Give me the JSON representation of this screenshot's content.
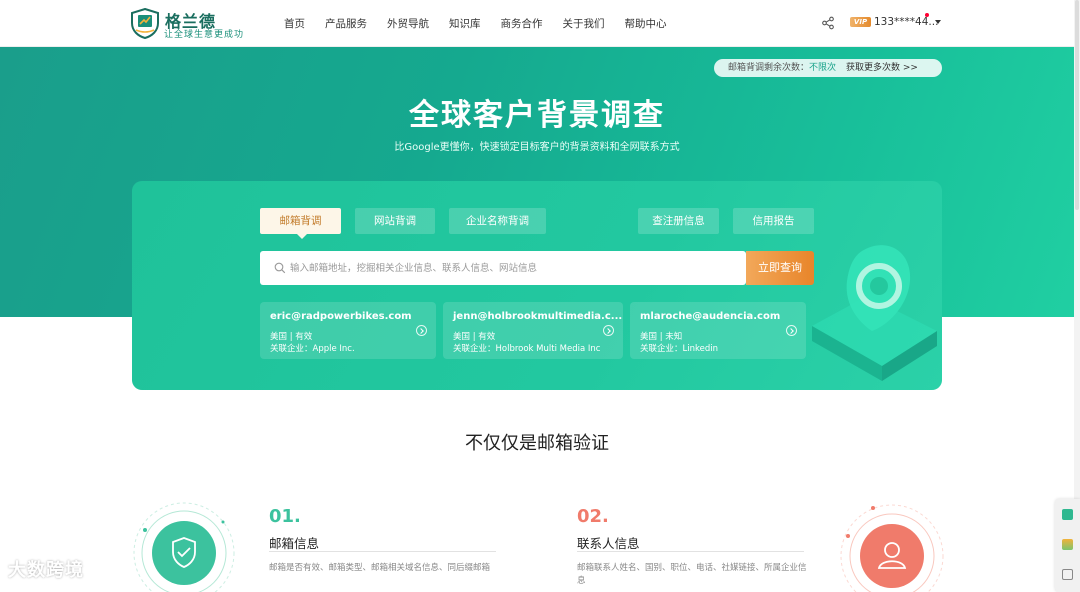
{
  "header": {
    "logo_name": "格兰德",
    "logo_slogan": "让全球生意更成功",
    "nav": [
      "首页",
      "产品服务",
      "外贸导航",
      "知识库",
      "商务合作",
      "关于我们",
      "帮助中心"
    ],
    "vip_badge": "VIP",
    "user_phone": "133****44...",
    "share_icon": "share-icon"
  },
  "hero": {
    "quota_label": "邮箱背调剩余次数：",
    "quota_value": "不限次",
    "quota_more": "获取更多次数 >>",
    "title": "全球客户背景调查",
    "subtitle": "比Google更懂你，快速锁定目标客户的背景资料和全网联系方式"
  },
  "search": {
    "tabs": [
      "邮箱背调",
      "网站背调",
      "企业名称背调",
      "查注册信息",
      "信用报告"
    ],
    "active_tab": "邮箱背调",
    "placeholder": "输入邮箱地址，挖掘相关企业信息、联系人信息、网站信息",
    "button": "立即查询"
  },
  "samples": [
    {
      "email": "eric@radpowerbikes.com",
      "meta": "美国 | 有效",
      "corp": "关联企业：Apple Inc."
    },
    {
      "email": "jenn@holbrookmultimedia.c...",
      "meta": "美国 | 有效",
      "corp": "关联企业：Holbrook Multi Media Inc"
    },
    {
      "email": "mlaroche@audencia.com",
      "meta": "美国 | 未知",
      "corp": "关联企业：Linkedin"
    }
  ],
  "features": {
    "section_title": "不仅仅是邮箱验证",
    "items": [
      {
        "num": "01.",
        "title": "邮箱信息",
        "desc": "邮箱是否有效、邮箱类型、邮箱相关域名信息、同后缀邮箱",
        "color": "#3cc29e"
      },
      {
        "num": "02.",
        "title": "联系人信息",
        "desc": "邮箱联系人姓名、国别、职位、电话、社媒链接、所属企业信息",
        "color": "#f07b6b"
      }
    ]
  },
  "watermark": "大数跨境",
  "colors": {
    "brand": "#1aa38b",
    "accent_orange": "#e8852a",
    "hero_start": "#1a9e8b",
    "hero_end": "#20cfa2"
  }
}
